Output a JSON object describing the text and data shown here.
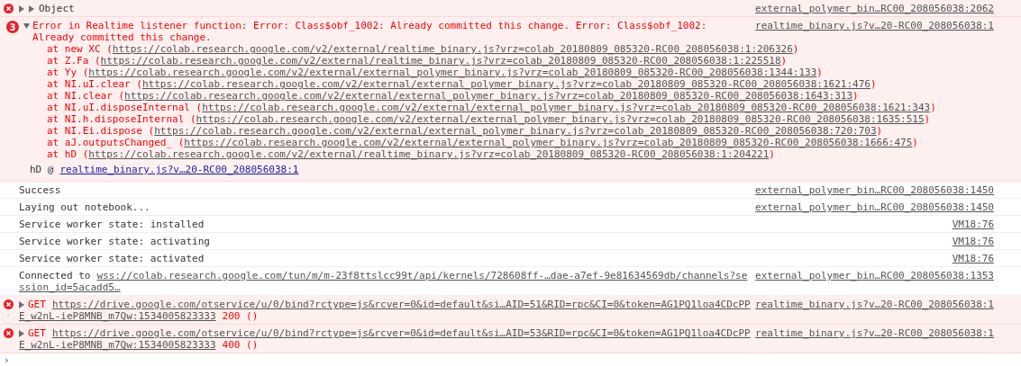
{
  "messages": [
    {
      "kind": "error-object",
      "expanded": false,
      "text": "Object",
      "source": "external_polymer_bin…RC00_208056038:2062"
    },
    {
      "kind": "error-stack",
      "count": "3",
      "expanded": true,
      "text": "Error in Realtime listener function: Error: Class$obf_1002: Already committed this change. Error: Class$obf_1002: Already committed this change.",
      "source": "realtime_binary.js?v…20-RC00_208056038:1",
      "stack": [
        {
          "call": "at new XC (",
          "url": "https://colab.research.google.com/v2/external/realtime_binary.js?vrz=colab_20180809_085320-RC00_208056038:1:206326",
          "close": ")"
        },
        {
          "call": "at Z.Fa (",
          "url": "https://colab.research.google.com/v2/external/realtime_binary.js?vrz=colab_20180809_085320-RC00_208056038:1:225518",
          "close": ")"
        },
        {
          "call": "at Yy (",
          "url": "https://colab.research.google.com/v2/external/external_polymer_binary.js?vrz=colab_20180809_085320-RC00_208056038:1344:133",
          "close": ")"
        },
        {
          "call": "at NI.uI.clear (",
          "url": "https://colab.research.google.com/v2/external/external_polymer_binary.js?vrz=colab_20180809_085320-RC00_208056038:1621:476",
          "close": ")"
        },
        {
          "call": "at NI.clear (",
          "url": "https://colab.research.google.com/v2/external/external_polymer_binary.js?vrz=colab_20180809_085320-RC00_208056038:1643:313",
          "close": ")"
        },
        {
          "call": "at NI.uI.disposeInternal (",
          "url": "https://colab.research.google.com/v2/external/external_polymer_binary.js?vrz=colab_20180809_085320-RC00_208056038:1621:343",
          "close": ")"
        },
        {
          "call": "at NI.h.disposeInternal (",
          "url": "https://colab.research.google.com/v2/external/external_polymer_binary.js?vrz=colab_20180809_085320-RC00_208056038:1635:515",
          "close": ")"
        },
        {
          "call": "at NI.Ei.dispose (",
          "url": "https://colab.research.google.com/v2/external/external_polymer_binary.js?vrz=colab_20180809_085320-RC00_208056038:720:703",
          "close": ")"
        },
        {
          "call": "at aJ.outputsChanged_ (",
          "url": "https://colab.research.google.com/v2/external/external_polymer_binary.js?vrz=colab_20180809_085320-RC00_208056038:1666:475",
          "close": ")"
        },
        {
          "call": "at hD (",
          "url": "https://colab.research.google.com/v2/external/realtime_binary.js?vrz=colab_20180809_085320-RC00_208056038:1:204221",
          "close": ")"
        }
      ],
      "caller": {
        "fn": "hD @",
        "link": "realtime_binary.js?v…20-RC00_208056038:1"
      }
    },
    {
      "kind": "log",
      "text": "Success",
      "source": "external_polymer_bin…RC00_208056038:1450"
    },
    {
      "kind": "log",
      "text": "Laying out notebook...",
      "source": "external_polymer_bin…RC00_208056038:1450"
    },
    {
      "kind": "log",
      "text": "Service worker state: installed",
      "source": "VM18:76"
    },
    {
      "kind": "log",
      "text": "Service worker state: activating",
      "source": "VM18:76"
    },
    {
      "kind": "log",
      "text": "Service worker state: activated",
      "source": "VM18:76"
    },
    {
      "kind": "log",
      "text": "Connected to",
      "link_lines": [
        "wss://colab.research.google.com/tun/m/m-23f8ttslcc99t/api/kernels/728608ff-…dae-a7ef-9e81634569db/channels?se",
        "ssion_id=5acadd5…"
      ],
      "source": "external_polymer_bin…RC00_208056038:1353"
    },
    {
      "kind": "network-error",
      "expanded": false,
      "method": "GET",
      "url_lines": [
        "https://drive.google.com/otservice/u/0/bind?rctype=js&rcver=0&id=default&si…AID=51&RID=rpc&CI=0&token=AG1PQ1loa4CDcPP",
        "E_w2nL-ieP8MNB_m7Qw:1534005823333"
      ],
      "status": "200 ()",
      "source": "realtime_binary.js?v…20-RC00_208056038:1"
    },
    {
      "kind": "network-error",
      "expanded": false,
      "method": "GET",
      "url_lines": [
        "https://drive.google.com/otservice/u/0/bind?rctype=js&rcver=0&id=default&si…AID=53&RID=rpc&CI=0&token=AG1PQ1loa4CDcPP",
        "E_w2nL-ieP8MNB_m7Qw:1534005823333"
      ],
      "status": "400 ()",
      "source": "realtime_binary.js?v…20-RC00_208056038:1"
    }
  ],
  "prompt": "›"
}
